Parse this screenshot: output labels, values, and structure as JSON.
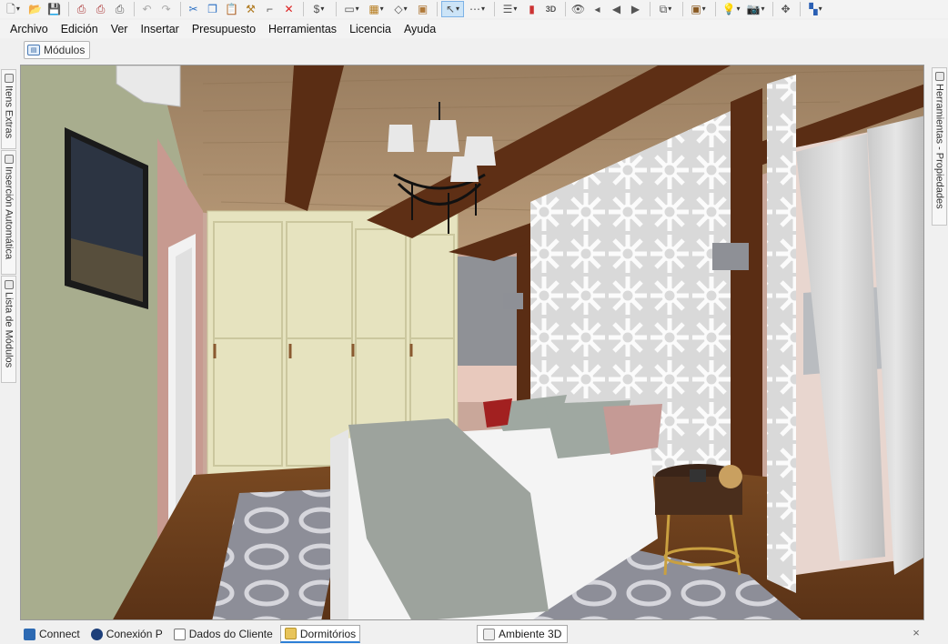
{
  "toolbar": {
    "icons": [
      "new-file-icon",
      "open-folder-icon",
      "save-icon",
      "print-icon",
      "print-preview-icon",
      "printer-icon",
      "undo-icon",
      "redo-icon",
      "cut-icon",
      "copy-icon",
      "paste-icon",
      "hammer-icon",
      "rotate-icon",
      "delete-icon",
      "budget-icon",
      "select-icon",
      "group-icon",
      "edit-shape-icon",
      "module-icon",
      "pointer-icon",
      "measure-icon",
      "layers-icon",
      "view-3d-icon",
      "eye-icon",
      "camera-nav-icon",
      "walls-icon",
      "box-icon",
      "light-icon",
      "render-icon",
      "move-icon",
      "palette-icon"
    ],
    "label_3d": "3D"
  },
  "menu": {
    "items": [
      "Archivo",
      "Edición",
      "Ver",
      "Insertar",
      "Presupuesto",
      "Herramientas",
      "Licencia",
      "Ayuda"
    ]
  },
  "module_tab": {
    "label": "Módulos"
  },
  "side_left": {
    "tab1": "Itens Extras",
    "tab2": "Inserción Automática",
    "tab3": "Lista de Módulos"
  },
  "side_right": {
    "tab1": "Herramientas - Propiedades"
  },
  "bottom": {
    "tabs": [
      {
        "label": "Connect",
        "icon": "rss-icon"
      },
      {
        "label": "Conexión P",
        "icon": "connection-icon"
      },
      {
        "label": "Dados do Cliente",
        "icon": "document-icon"
      },
      {
        "label": "Dormitórios",
        "icon": "folder-icon"
      }
    ],
    "environment_tab": "Ambiente 3D",
    "close": "×"
  }
}
